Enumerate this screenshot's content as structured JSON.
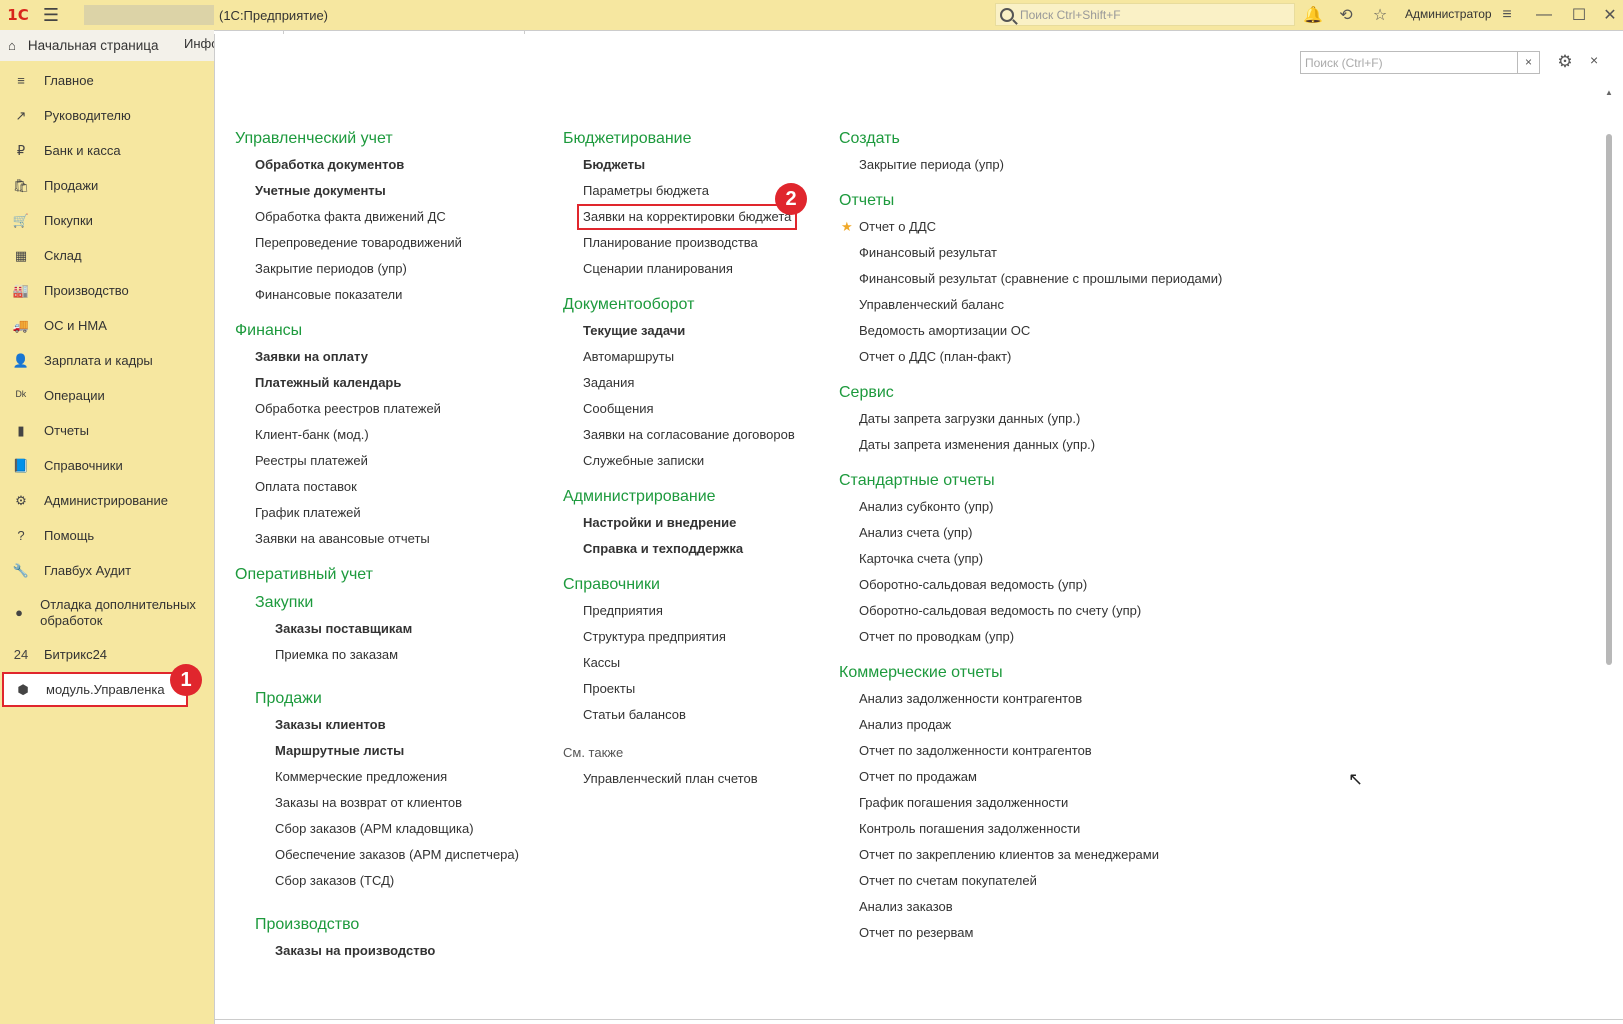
{
  "titlebar": {
    "logo": "1С",
    "app_title": "(1С:Предприятие)",
    "search_placeholder": "Поиск Ctrl+Shift+F",
    "user": "Администратор"
  },
  "sidebar": {
    "home_label": "Начальная страница",
    "second_tab": "Инфо",
    "items": [
      {
        "label": "Главное",
        "icon": "≡"
      },
      {
        "label": "Руководителю",
        "icon": "↗"
      },
      {
        "label": "Банк и касса",
        "icon": "₽"
      },
      {
        "label": "Продажи",
        "icon": "🛍"
      },
      {
        "label": "Покупки",
        "icon": "🛒"
      },
      {
        "label": "Склад",
        "icon": "▦"
      },
      {
        "label": "Производство",
        "icon": "🏭"
      },
      {
        "label": "ОС и НМА",
        "icon": "🚚"
      },
      {
        "label": "Зарплата и кадры",
        "icon": "👤"
      },
      {
        "label": "Операции",
        "icon": "ᴰᵏ"
      },
      {
        "label": "Отчеты",
        "icon": "▮"
      },
      {
        "label": "Справочники",
        "icon": "📘"
      },
      {
        "label": "Администрирование",
        "icon": "⚙"
      },
      {
        "label": "Помощь",
        "icon": "?"
      },
      {
        "label": "Главбух Аудит",
        "icon": "🔧"
      },
      {
        "label": "Отладка дополнительных обработок",
        "icon": "●"
      },
      {
        "label": "Битрикс24",
        "icon": "24"
      },
      {
        "label": "модуль.Управленка",
        "icon": "⬢"
      }
    ],
    "badge1": "1"
  },
  "form": {
    "search_placeholder": "Поиск (Ctrl+F)",
    "search_clear": "×",
    "close": "×"
  },
  "columns": {
    "c1": {
      "s1_title": "Управленческий учет",
      "s1_items": [
        "Обработка документов",
        "Учетные документы",
        "Обработка факта движений ДС",
        "Перепроведение товародвижений",
        "Закрытие периодов (упр)",
        "Финансовые показатели"
      ],
      "s2_title": "Финансы",
      "s2_items": [
        "Заявки на оплату",
        "Платежный календарь",
        "Обработка реестров платежей",
        "Клиент-банк (мод.)",
        "Реестры платежей",
        "Оплата поставок",
        "График платежей",
        "Заявки на авансовые отчеты"
      ],
      "s3_title": "Оперативный учет",
      "s3_sub1": "Закупки",
      "s3_sub1_items": [
        "Заказы поставщикам",
        "Приемка по заказам"
      ],
      "s3_sub2": "Продажи",
      "s3_sub2_items": [
        "Заказы клиентов",
        "Маршрутные листы",
        "Коммерческие предложения",
        "Заказы на возврат от клиентов",
        "Сбор заказов (АРМ кладовщика)",
        "Обеспечение заказов (АРМ диспетчера)",
        "Сбор заказов (ТСД)"
      ],
      "s3_sub3": "Производство",
      "s3_sub3_items": [
        "Заказы на производство"
      ]
    },
    "c2": {
      "s1_title": "Бюджетирование",
      "s1_items": [
        "Бюджеты",
        "Параметры бюджета",
        "Заявки на корректировки бюджета",
        "Планирование производства",
        "Сценарии планирования"
      ],
      "s2_title": "Документооборот",
      "s2_items": [
        "Текущие задачи",
        "Автомаршруты",
        "Задания",
        "Сообщения",
        "Заявки на согласование договоров",
        "Служебные записки"
      ],
      "s3_title": "Администрирование",
      "s3_items": [
        "Настройки и внедрение",
        "Справка и техподдержка"
      ],
      "s4_title": "Справочники",
      "s4_items": [
        "Предприятия",
        "Структура предприятия",
        "Кассы",
        "Проекты",
        "Статьи балансов"
      ],
      "see_also": "См. также",
      "see_items": [
        "Управленческий план счетов"
      ],
      "badge2": "2"
    },
    "c3": {
      "s1_title": "Создать",
      "s1_items": [
        "Закрытие периода (упр)"
      ],
      "s2_title": "Отчеты",
      "s2_items": [
        "Отчет о ДДС",
        "Финансовый результат",
        "Финансовый результат (сравнение с прошлыми периодами)",
        "Управленческий баланс",
        "Ведомость амортизации ОС",
        "Отчет о ДДС (план-факт)"
      ],
      "s3_title": "Сервис",
      "s3_items": [
        "Даты запрета загрузки данных (упр.)",
        "Даты запрета изменения данных (упр.)"
      ],
      "s4_title": "Стандартные отчеты",
      "s4_items": [
        "Анализ субконто (упр)",
        "Анализ счета (упр)",
        "Карточка счета (упр)",
        "Оборотно-сальдовая ведомость (упр)",
        "Оборотно-сальдовая ведомость по счету (упр)",
        "Отчет по проводкам (упр)"
      ],
      "s5_title": "Коммерческие отчеты",
      "s5_items": [
        "Анализ задолженности контрагентов",
        "Анализ продаж",
        "Отчет по задолженности контрагентов",
        "Отчет по продажам",
        "График погашения задолженности",
        "Контроль погашения задолженности",
        "Отчет по закреплению клиентов за менеджерами",
        "Отчет по счетам покупателей",
        "Анализ заказов",
        "Отчет по резервам"
      ]
    }
  },
  "colors": {
    "accent_green": "#1d9a3d",
    "highlight_red": "#e0262d",
    "panel_yellow": "#f6e7a0"
  }
}
